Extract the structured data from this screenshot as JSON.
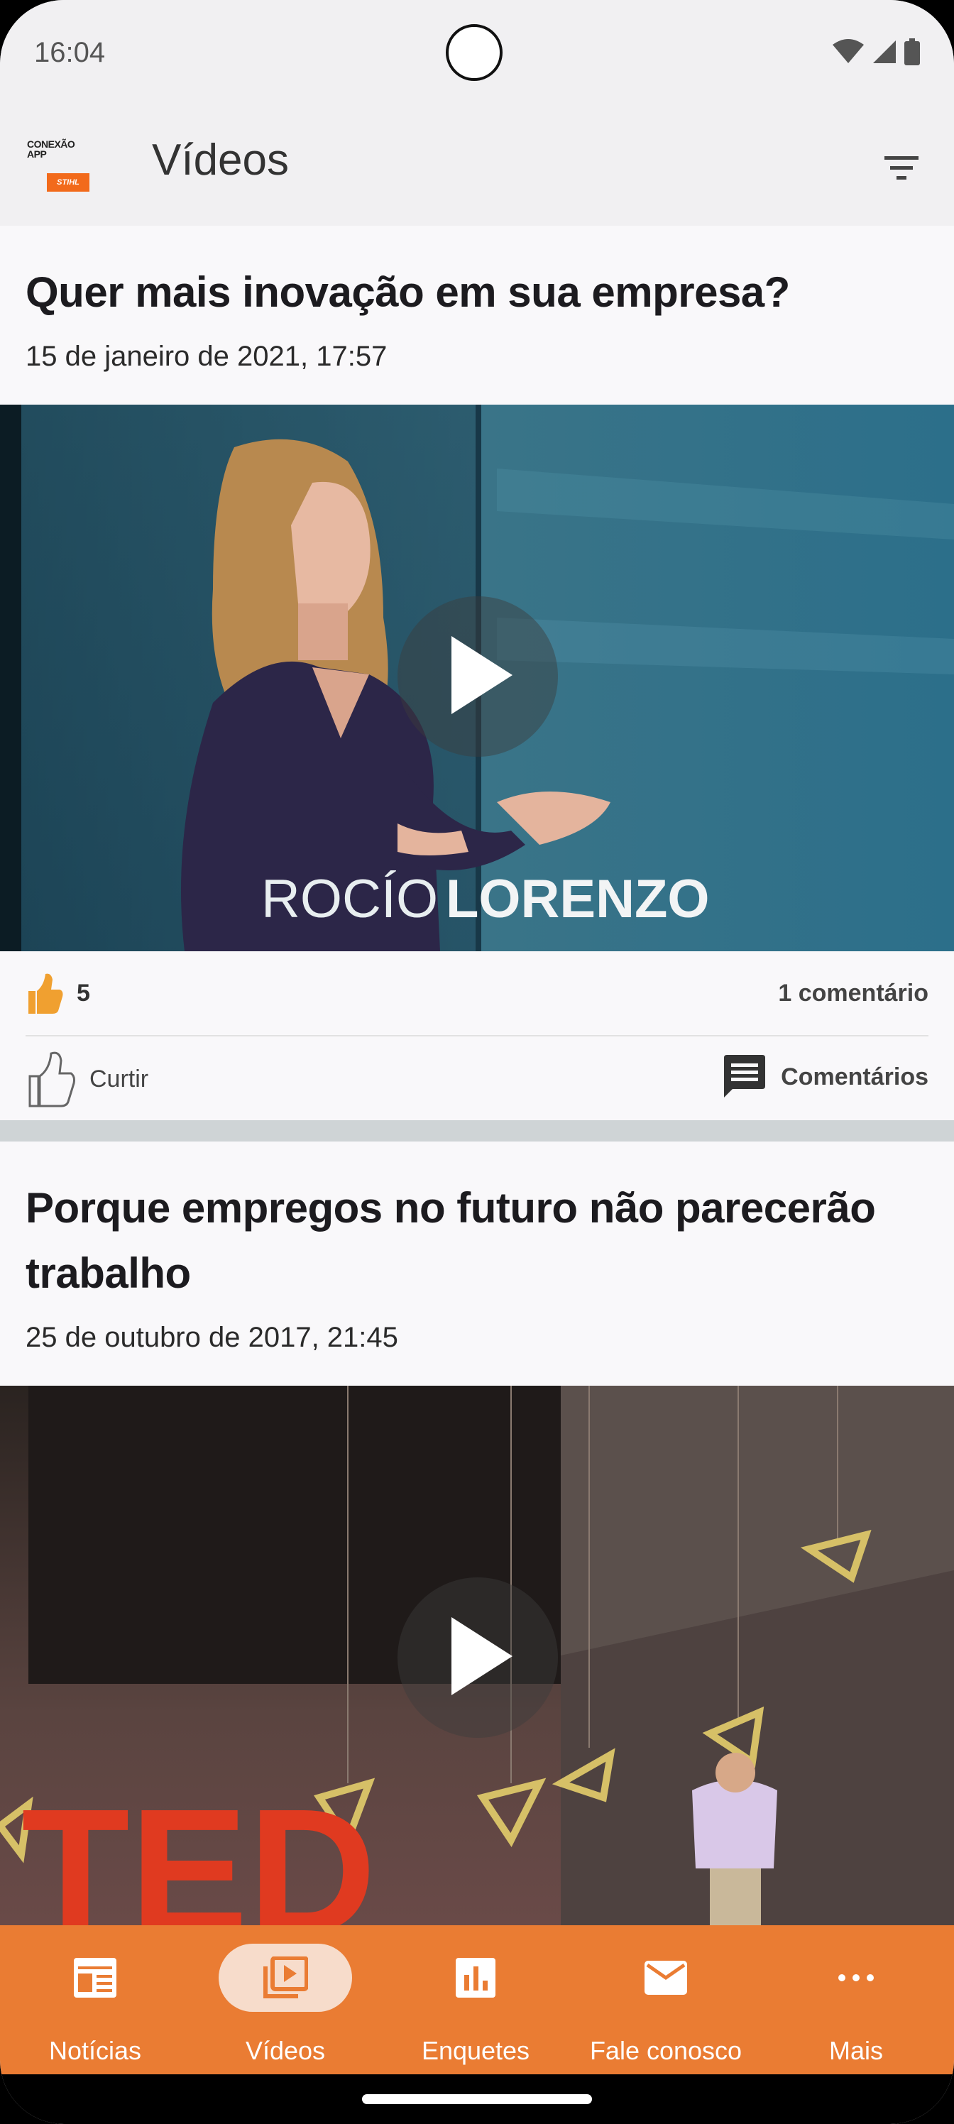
{
  "status_bar": {
    "time": "16:04"
  },
  "app_bar": {
    "logo_text": "CONEXÃO APP",
    "logo_brand": "STIHL",
    "title": "Vídeos"
  },
  "posts": [
    {
      "title": "Quer mais inovação em sua empresa?",
      "date": "15 de janeiro de 2021, 17:57",
      "video_caption_light": "ROCÍO",
      "video_caption_bold": "LORENZO",
      "likes": "5",
      "comments": "1 comentário",
      "like_label": "Curtir",
      "comments_label": "Comentários"
    },
    {
      "title": "Porque empregos no futuro não parecerão trabalho",
      "date": "25 de outubro de 2017, 21:45",
      "video_caption": "TED"
    }
  ],
  "bottom_nav": {
    "items": [
      {
        "label": "Notícias",
        "icon": "news-icon"
      },
      {
        "label": "Vídeos",
        "icon": "video-library-icon",
        "active": true
      },
      {
        "label": "Enquetes",
        "icon": "poll-icon"
      },
      {
        "label": "Fale conosco",
        "icon": "mail-icon"
      },
      {
        "label": "Mais",
        "icon": "more-icon"
      }
    ]
  },
  "colors": {
    "accent": "#ea7c33",
    "active_pill": "#f7dccb",
    "like_filled": "#f0a030"
  }
}
